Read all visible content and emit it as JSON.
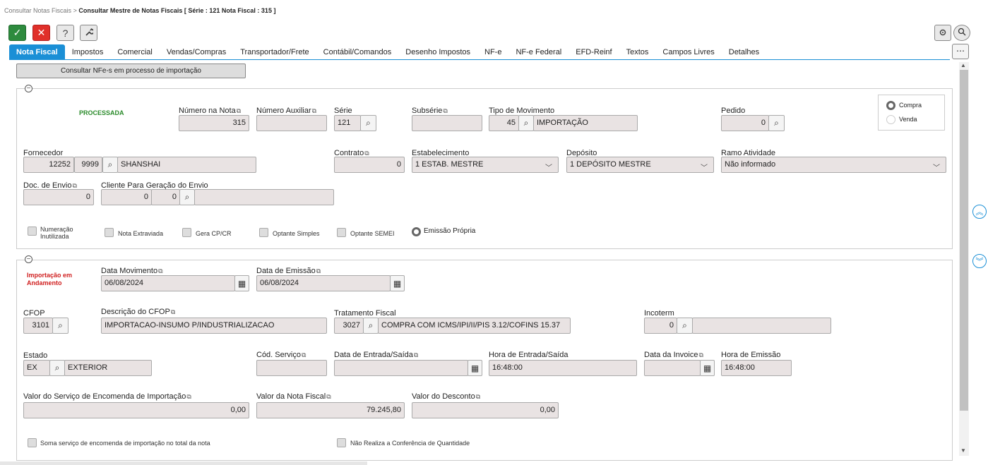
{
  "breadcrumb": {
    "parent": "Consultar Notas Fiscais",
    "sep": ">",
    "current": "Consultar Mestre de Notas Fiscais [ Série : 121 Nota Fiscal : 315 ]"
  },
  "toolbar": {
    "ok": "✓",
    "cancel": "✕",
    "help": "?",
    "tools": "🔧"
  },
  "tabs": [
    "Nota Fiscal",
    "Impostos",
    "Comercial",
    "Vendas/Compras",
    "Transportador/Frete",
    "Contábil/Comandos",
    "Desenho Impostos",
    "NF-e",
    "NF-e Federal",
    "EFD-Reinf",
    "Textos",
    "Campos Livres",
    "Detalhes"
  ],
  "import_button": "Consultar NFe-s em processo de importação",
  "s1": {
    "status": "PROCESSADA",
    "numero_nota": {
      "label": "Número na Nota",
      "value": "315"
    },
    "numero_aux": {
      "label": "Número Auxiliar",
      "value": ""
    },
    "serie": {
      "label": "Série",
      "value": "121"
    },
    "subserie": {
      "label": "Subsérie",
      "value": ""
    },
    "tipo_mov": {
      "label": "Tipo de Movimento",
      "code": "45",
      "desc": "IMPORTAÇÃO"
    },
    "pedido": {
      "label": "Pedido",
      "value": "0"
    },
    "compra": "Compra",
    "venda": "Venda",
    "fornecedor": {
      "label": "Fornecedor",
      "code": "12252",
      "code2": "9999",
      "name": "SHANSHAI"
    },
    "contrato": {
      "label": "Contrato",
      "value": "0"
    },
    "estabelecimento": {
      "label": "Estabelecimento",
      "value": "1 ESTAB. MESTRE"
    },
    "deposito": {
      "label": "Depósito",
      "value": "1 DEPÓSITO MESTRE"
    },
    "ramo": {
      "label": "Ramo Atividade",
      "value": "Não informado"
    },
    "doc_envio": {
      "label": "Doc. de Envio",
      "value": "0"
    },
    "cliente_envio": {
      "label": "Cliente Para Geração do Envio",
      "v1": "0",
      "v2": "0",
      "v3": ""
    },
    "checks": {
      "num_inut1": "Numeração",
      "num_inut2": "Inutilizada",
      "extraviada": "Nota Extraviada",
      "gera_cp": "Gera CP/CR",
      "simples": "Optante Simples",
      "semei": "Optante SEMEI",
      "emissao": "Emissão Própria"
    }
  },
  "s2": {
    "status1": "Importação em",
    "status2": "Andamento",
    "data_mov": {
      "label": "Data Movimento",
      "value": "06/08/2024"
    },
    "data_emissao": {
      "label": "Data de Emissão",
      "value": "06/08/2024"
    },
    "cfop": {
      "label": "CFOP",
      "value": "3101"
    },
    "desc_cfop": {
      "label": "Descrição do CFOP",
      "value": "IMPORTACAO-INSUMO P/INDUSTRIALIZACAO"
    },
    "trat_fiscal": {
      "label": "Tratamento Fiscal",
      "code": "3027",
      "desc": "COMPRA COM ICMS/IPI/II/PIS 3.12/COFINS 15.37"
    },
    "incoterm": {
      "label": "Incoterm",
      "code": "0",
      "desc": ""
    },
    "estado": {
      "label": "Estado",
      "code": "EX",
      "desc": "EXTERIOR"
    },
    "cod_servico": {
      "label": "Cód. Serviço",
      "value": ""
    },
    "data_entrada": {
      "label": "Data de Entrada/Saída",
      "value": ""
    },
    "hora_entrada": {
      "label": "Hora de Entrada/Saída",
      "value": "16:48:00"
    },
    "data_invoice": {
      "label": "Data da Invoice",
      "value": ""
    },
    "hora_emissao": {
      "label": "Hora de Emissão",
      "value": "16:48:00"
    },
    "valor_servico": {
      "label": "Valor do Serviço de Encomenda de Importação",
      "value": "0,00"
    },
    "valor_nota": {
      "label": "Valor da Nota Fiscal",
      "value": "79.245,80"
    },
    "valor_desconto": {
      "label": "Valor do Desconto",
      "value": "0,00"
    },
    "soma_servico": "Soma serviço de encomenda de importação no total da nota",
    "nao_conferencia": "Não Realiza a Conferência de Quantidade"
  },
  "colors": {
    "accent": "#1a8fd6",
    "ok": "#2e8b3e",
    "cancel": "#e0302a",
    "processed": "#2a8a2a",
    "pending": "#d02020"
  }
}
